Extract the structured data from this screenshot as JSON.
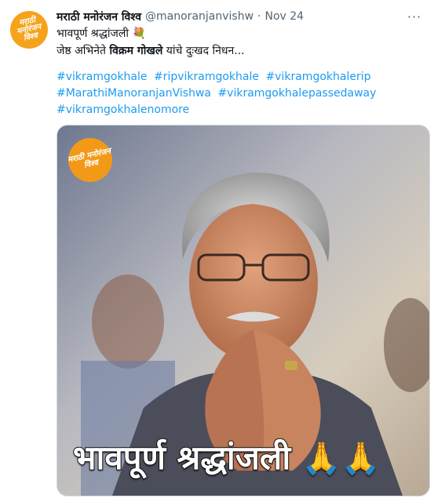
{
  "tweet": {
    "author_name": "मराठी मनोरंजन विश्व",
    "handle": "@manoranjanvishw",
    "separator": "·",
    "time": "Nov 24",
    "more_icon": "more-dots-icon",
    "line1": "भावपूर्ण श्रद्धांजली 💐",
    "line2_prefix": "जेष्ठ अभिनेते ",
    "line2_bold": "विक्रम गोखले",
    "line2_suffix": " यांचे दुःखद निधन...",
    "hashtags": [
      "#vikramgokhale",
      "#ripvikramgokhale",
      "#vikramgokhalerip",
      "#MarathiManoranjanVishwa",
      "#vikramgokhalepassedaway",
      "#vikramgokhalenomore"
    ]
  },
  "avatar": {
    "logo_text": "मराठी मनोरंजन विश्व"
  },
  "media": {
    "watermark_text": "मराठी मनोरंजन विश्व",
    "caption": "भावपूर्ण श्रद्धांजली",
    "caption_emoji": "🙏🙏"
  },
  "colors": {
    "link": "#1d9bf0",
    "secondary": "#536471",
    "brand_orange": "#f6a21a"
  }
}
